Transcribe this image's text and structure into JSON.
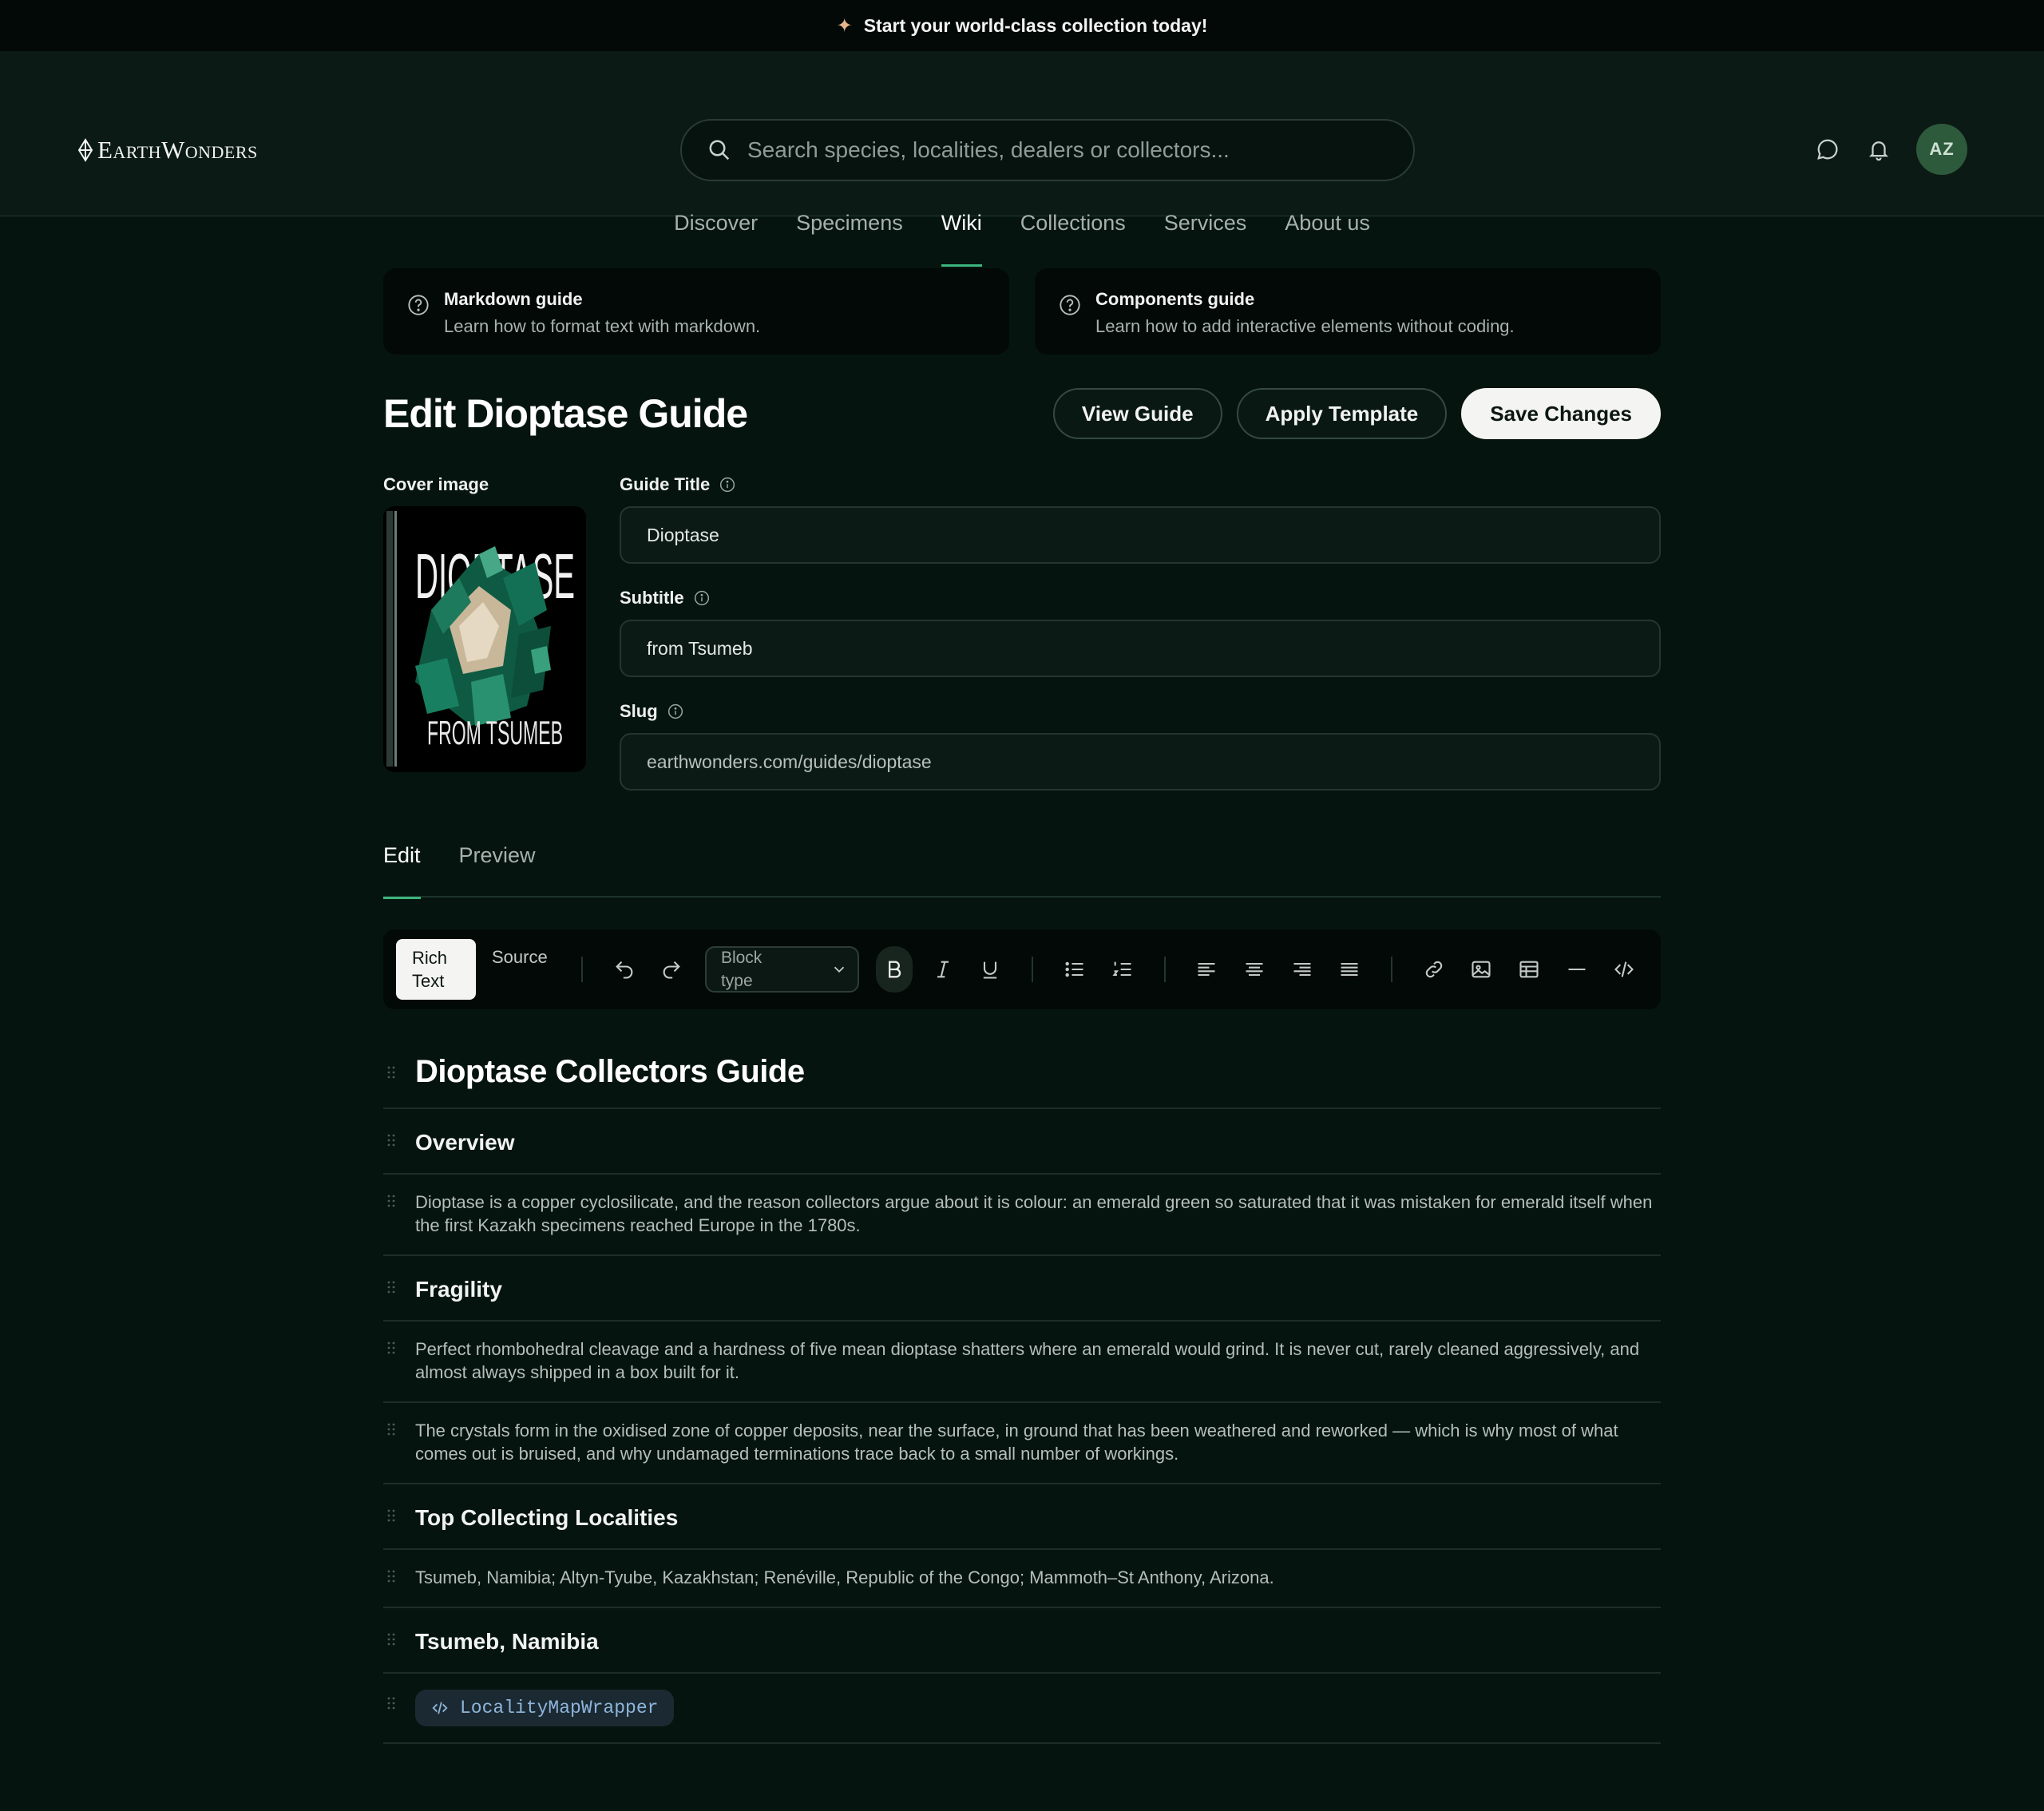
{
  "announcement": {
    "text": "Start your world-class collection today!"
  },
  "header": {
    "logo": "EarthWonders",
    "search_placeholder": "Search species, localities, dealers or collectors...",
    "avatar_initials": "AZ"
  },
  "nav": {
    "items": [
      "Discover",
      "Specimens",
      "Wiki",
      "Collections",
      "Services",
      "About us"
    ],
    "active": "Wiki"
  },
  "guides": [
    {
      "title": "Markdown guide",
      "desc": "Learn how to format text with markdown."
    },
    {
      "title": "Components guide",
      "desc": "Learn how to add interactive elements without coding."
    }
  ],
  "page": {
    "title": "Edit Dioptase Guide",
    "view_label": "View Guide",
    "template_label": "Apply Template",
    "save_label": "Save Changes"
  },
  "form": {
    "cover_label": "Cover image",
    "cover_title": "DIOPTASE",
    "cover_subtitle": "FROM TSUMEB",
    "title_label": "Guide Title",
    "title_value": "Dioptase",
    "subtitle_label": "Subtitle",
    "subtitle_value": "from Tsumeb",
    "slug_label": "Slug",
    "slug_value": "earthwonders.com/guides/dioptase"
  },
  "tabs": {
    "edit": "Edit",
    "preview": "Preview",
    "active": "Edit"
  },
  "toolbar": {
    "rich_text": "Rich Text",
    "source": "Source",
    "block_type": "Block type",
    "active_mode": "Rich Text"
  },
  "blocks": [
    {
      "type": "h1",
      "text": "Dioptase Collectors Guide"
    },
    {
      "type": "h2",
      "text": "Overview"
    },
    {
      "type": "p",
      "text": "Dioptase is a copper cyclosilicate, and the reason collectors argue about it is colour: an emerald green so saturated that it was mistaken for emerald itself when the first Kazakh specimens reached Europe in the 1780s."
    },
    {
      "type": "h2",
      "text": "Fragility"
    },
    {
      "type": "p",
      "text": "Perfect rhombohedral cleavage and a hardness of five mean dioptase shatters where an emerald would grind. It is never cut, rarely cleaned aggressively, and almost always shipped in a box built for it."
    },
    {
      "type": "p",
      "text": "The crystals form in the oxidised zone of copper deposits, near the surface, in ground that has been weathered and reworked — which is why most of what comes out is bruised, and why undamaged terminations trace back to a small number of workings."
    },
    {
      "type": "h2",
      "text": "Top Collecting Localities"
    },
    {
      "type": "p",
      "text": "Tsumeb, Namibia; Altyn-Tyube, Kazakhstan; Renéville, Republic of the Congo; Mammoth–St Anthony, Arizona."
    },
    {
      "type": "h2",
      "text": "Tsumeb, Namibia"
    },
    {
      "type": "component",
      "text": "LocalityMapWrapper"
    }
  ]
}
